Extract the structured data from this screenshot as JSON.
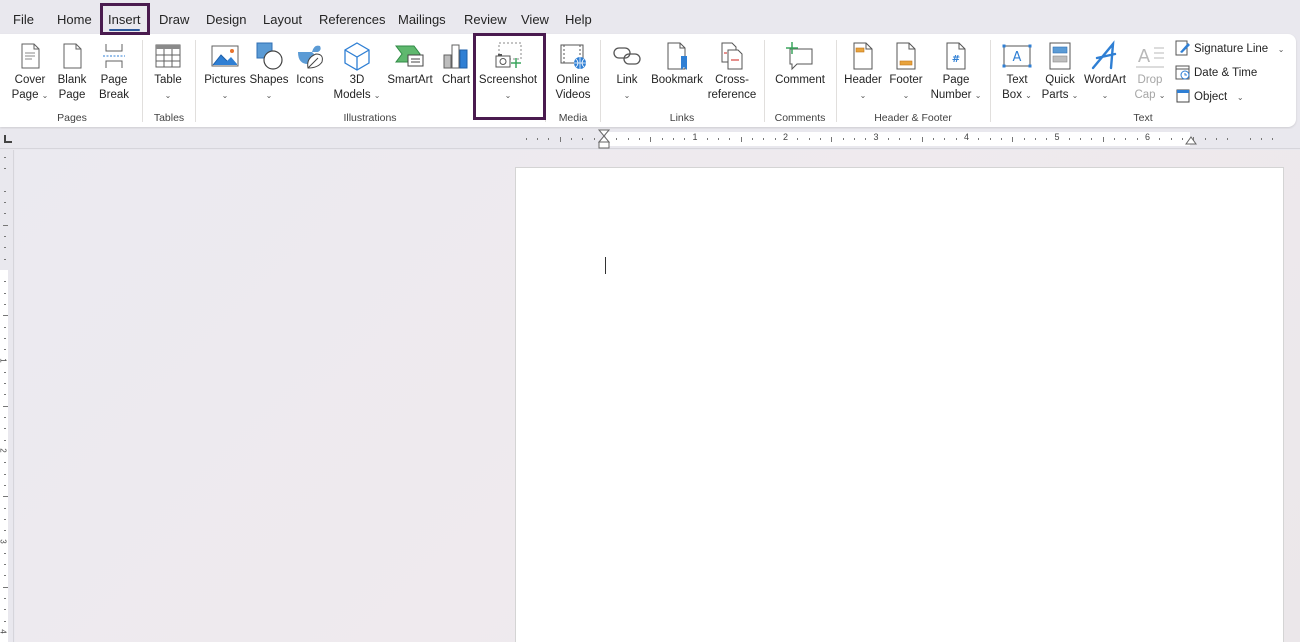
{
  "menu": {
    "tabs": [
      {
        "label": "File"
      },
      {
        "label": "Home"
      },
      {
        "label": "Insert",
        "active": true
      },
      {
        "label": "Draw"
      },
      {
        "label": "Design"
      },
      {
        "label": "Layout"
      },
      {
        "label": "References"
      },
      {
        "label": "Mailings"
      },
      {
        "label": "Review"
      },
      {
        "label": "View"
      },
      {
        "label": "Help"
      }
    ]
  },
  "ribbon": {
    "groups": {
      "pages": "Pages",
      "tables": "Tables",
      "illustrations": "Illustrations",
      "media": "Media",
      "links": "Links",
      "comments": "Comments",
      "header_footer": "Header & Footer",
      "text": "Text"
    },
    "buttons": {
      "cover_page": {
        "line1": "Cover",
        "line2": "Page",
        "icon": "cover-page-icon",
        "dropdown": true
      },
      "blank_page": {
        "line1": "Blank",
        "line2": "Page",
        "icon": "blank-page-icon"
      },
      "page_break": {
        "line1": "Page",
        "line2": "Break",
        "icon": "page-break-icon"
      },
      "table": {
        "line1": "Table",
        "icon": "table-icon",
        "dropdown": true
      },
      "pictures": {
        "line1": "Pictures",
        "icon": "pictures-icon",
        "dropdown": true
      },
      "shapes": {
        "line1": "Shapes",
        "icon": "shapes-icon",
        "dropdown": true
      },
      "icons": {
        "line1": "Icons",
        "icon": "icons-icon"
      },
      "models3d": {
        "line1": "3D",
        "line2": "Models",
        "icon": "3d-models-icon",
        "dropdown": true
      },
      "smartart": {
        "line1": "SmartArt",
        "icon": "smartart-icon"
      },
      "chart": {
        "line1": "Chart",
        "icon": "chart-icon"
      },
      "screenshot": {
        "line1": "Screenshot",
        "icon": "screenshot-icon",
        "dropdown": true,
        "highlighted": true
      },
      "online_videos": {
        "line1": "Online",
        "line2": "Videos",
        "icon": "online-videos-icon"
      },
      "link": {
        "line1": "Link",
        "icon": "link-icon",
        "dropdown": true
      },
      "bookmark": {
        "line1": "Bookmark",
        "icon": "bookmark-icon"
      },
      "cross_reference": {
        "line1": "Cross-",
        "line2": "reference",
        "icon": "cross-reference-icon"
      },
      "comment": {
        "line1": "Comment",
        "icon": "comment-icon"
      },
      "header": {
        "line1": "Header",
        "icon": "header-icon",
        "dropdown": true
      },
      "footer": {
        "line1": "Footer",
        "icon": "footer-icon",
        "dropdown": true
      },
      "page_number": {
        "line1": "Page",
        "line2": "Number",
        "icon": "page-number-icon",
        "dropdown": true
      },
      "text_box": {
        "line1": "Text",
        "line2": "Box",
        "icon": "text-box-icon",
        "dropdown": true
      },
      "quick_parts": {
        "line1": "Quick",
        "line2": "Parts",
        "icon": "quick-parts-icon",
        "dropdown": true
      },
      "wordart": {
        "line1": "WordArt",
        "icon": "wordart-icon",
        "dropdown": true
      },
      "drop_cap": {
        "line1": "Drop",
        "line2": "Cap",
        "icon": "drop-cap-icon",
        "dropdown": true,
        "disabled": true
      },
      "signature_line": {
        "label": "Signature Line",
        "icon": "signature-line-icon",
        "dropdown": true
      },
      "date_time": {
        "label": "Date & Time",
        "icon": "date-time-icon"
      },
      "object": {
        "label": "Object",
        "icon": "object-icon",
        "dropdown": true
      }
    },
    "caret": "⌄"
  },
  "ruler": {
    "numbers": [
      "1",
      "2",
      "3",
      "4",
      "5",
      "6"
    ],
    "vnumbers": [
      "1",
      "2",
      "3",
      "4"
    ]
  },
  "colors": {
    "highlight": "#4a1b4f",
    "active_tab_underline": "#2b579a",
    "accent_blue": "#2f7fd4",
    "accent_green": "#3aa55d",
    "accent_orange": "#e8a33c"
  }
}
